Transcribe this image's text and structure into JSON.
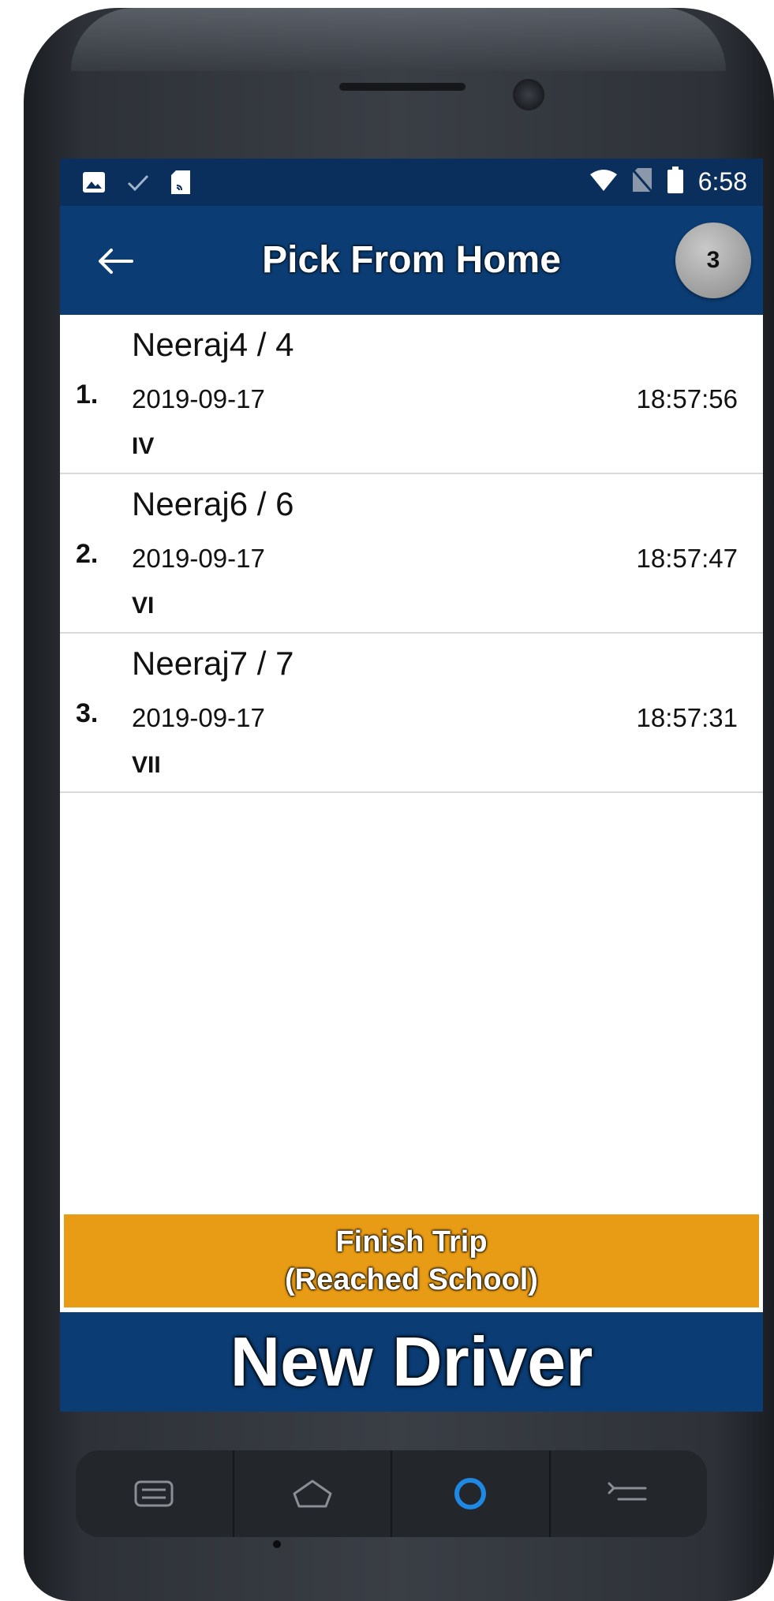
{
  "status_bar": {
    "time": "6:58",
    "left_icons": [
      "image-icon",
      "check-icon",
      "sd-card-icon"
    ],
    "right_icons": [
      "wifi-icon",
      "no-sim-icon",
      "battery-icon"
    ]
  },
  "app_bar": {
    "back_icon": "arrow-left-icon",
    "title": "Pick From Home",
    "count": "3"
  },
  "students": [
    {
      "index": "1.",
      "name": "Neeraj4 / 4",
      "date": "2019-09-17",
      "time": "18:57:56",
      "class": "IV"
    },
    {
      "index": "2.",
      "name": "Neeraj6 / 6",
      "date": "2019-09-17",
      "time": "18:57:47",
      "class": "VI"
    },
    {
      "index": "3.",
      "name": "Neeraj7 / 7",
      "date": "2019-09-17",
      "time": "18:57:31",
      "class": "VII"
    }
  ],
  "finish_button": {
    "line1": "Finish Trip",
    "line2": "(Reached School)"
  },
  "footer": {
    "title": "New Driver"
  },
  "nav_keys": [
    "menu-icon",
    "home-icon",
    "circle-icon",
    "back-icon"
  ],
  "colors": {
    "app_bar": "#0b3c73",
    "status_bar": "#0b2f5c",
    "finish_button": "#e89c16",
    "accent_blue": "#1e88e5"
  }
}
